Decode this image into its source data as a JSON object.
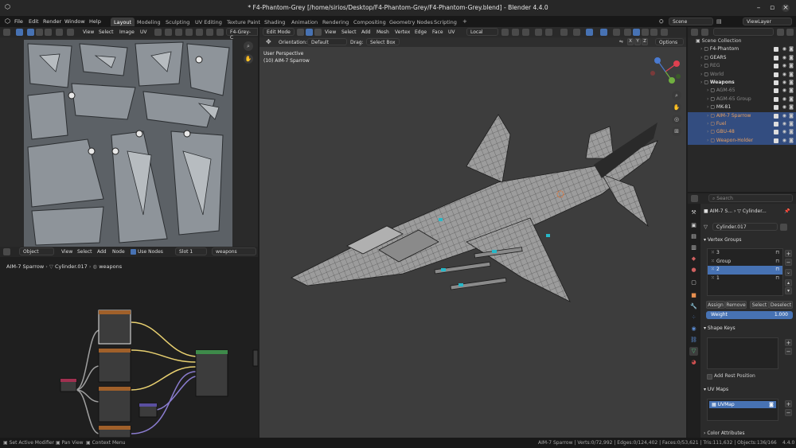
{
  "window": {
    "title": "* F4-Phantom-Grey [/home/sirios/Desktop/F4-Phantom-Grey/F4-Phantom-Grey.blend] - Blender 4.4.0"
  },
  "menu": [
    "File",
    "Edit",
    "Render",
    "Window",
    "Help"
  ],
  "workspaces": [
    "Layout",
    "Modeling",
    "Sculpting",
    "UV Editing",
    "Texture Paint",
    "Shading",
    "Animation",
    "Rendering",
    "Compositing",
    "Geometry Nodes",
    "Scripting"
  ],
  "scene": {
    "label": "Scene",
    "view_layer": "ViewLayer"
  },
  "image_editor": {
    "menus": [
      "View",
      "Select",
      "Image",
      "UV"
    ],
    "image_name": "F4-Grey-C"
  },
  "node_editor": {
    "object_mode": "Object",
    "menus": [
      "View",
      "Select",
      "Add",
      "Node"
    ],
    "use_nodes": "Use Nodes",
    "slot": "Slot 1",
    "material": "weapons",
    "breadcrumb": [
      "AIM-7 Sparrow",
      "Cylinder.017",
      "weapons"
    ]
  },
  "viewport": {
    "mode": "Edit Mode",
    "menus": [
      "View",
      "Select",
      "Add",
      "Mesh",
      "Vertex",
      "Edge",
      "Face",
      "UV"
    ],
    "transform_orientation": "Local",
    "orientation_label": "Orientation:",
    "orientation_value": "Default",
    "drag_label": "Drag:",
    "drag_value": "Select Box",
    "options": "Options",
    "axes": [
      "X",
      "Y",
      "Z"
    ],
    "info_line1": "User Perspective",
    "info_line2": "(10) AIM-7 Sparrow"
  },
  "outliner": {
    "search_placeholder": "",
    "root": "Scene Collection",
    "items": [
      {
        "name": "F4-Phantom",
        "indent": 1,
        "selected": false,
        "dim": false
      },
      {
        "name": "GEARS",
        "indent": 1,
        "selected": false,
        "dim": false
      },
      {
        "name": "REG",
        "indent": 1,
        "selected": false,
        "dim": true
      },
      {
        "name": "World",
        "indent": 1,
        "selected": false,
        "dim": true
      },
      {
        "name": "Weapons",
        "indent": 1,
        "selected": false,
        "dim": false,
        "bold": true
      },
      {
        "name": "AGM-65",
        "indent": 2,
        "selected": false,
        "dim": true
      },
      {
        "name": "AGM-65 Group",
        "indent": 2,
        "selected": false,
        "dim": true
      },
      {
        "name": "MK-81",
        "indent": 2,
        "selected": false,
        "dim": false
      },
      {
        "name": "AIM-7 Sparrow",
        "indent": 2,
        "selected": true,
        "dim": false,
        "color": "#e8a060"
      },
      {
        "name": "Fuel",
        "indent": 2,
        "selected": true,
        "dim": false,
        "color": "#e8a060"
      },
      {
        "name": "GBU-48",
        "indent": 2,
        "selected": true,
        "dim": false,
        "color": "#e8a060"
      },
      {
        "name": "Weapon-Holder",
        "indent": 2,
        "selected": true,
        "dim": false,
        "color": "#e8a060"
      }
    ]
  },
  "properties": {
    "search_placeholder": "Search",
    "breadcrumb_object": "AIM-7 S...",
    "breadcrumb_mesh": "Cylinder...",
    "mesh_name": "Cylinder.017",
    "vertex_groups_title": "Vertex Groups",
    "vertex_groups": [
      "3",
      "Group",
      "2",
      "1"
    ],
    "selected_group_index": 2,
    "assign": "Assign",
    "remove": "Remove",
    "select": "Select",
    "deselect": "Deselect",
    "weight_label": "Weight",
    "weight_value": "1.000",
    "shape_keys_title": "Shape Keys",
    "add_rest_position": "Add Rest Position",
    "uv_maps_title": "UV Maps",
    "uv_map": "UVMap",
    "color_attributes_title": "Color Attributes"
  },
  "statusbar": {
    "left": [
      "Set Active Modifier",
      "Pan View",
      "Context Menu"
    ],
    "stats": "AIM-7 Sparrow | Verts:0/72,992 | Edges:0/124,402 | Faces:0/53,621 | Tris:111,632 | Objects:136/166",
    "version": "4.4.0"
  },
  "colors": {
    "accent_blue": "#4772b3",
    "selection_row": "#334d80",
    "object_orange": "#e8a060",
    "active_workspace": "#3d3d3d"
  }
}
